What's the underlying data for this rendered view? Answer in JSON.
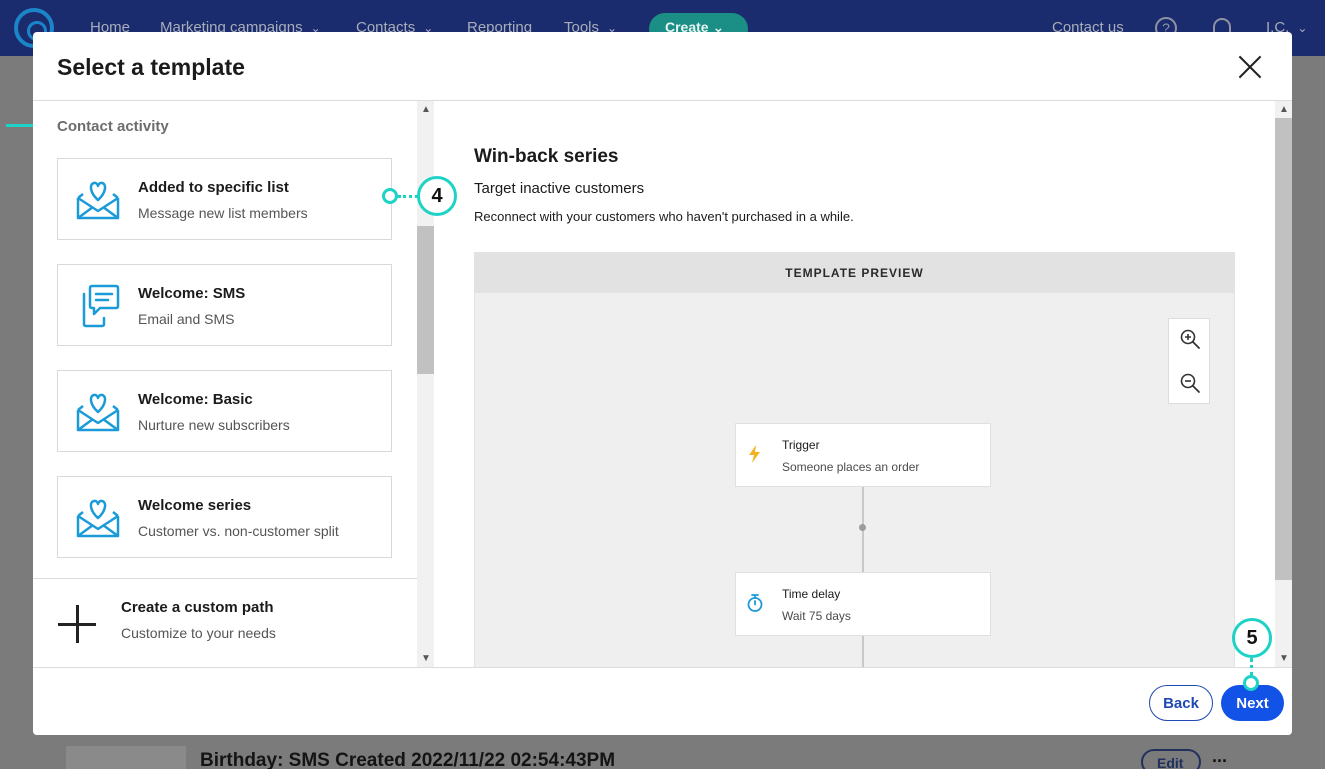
{
  "nav": {
    "items": [
      {
        "label": "Home",
        "dropdown": false
      },
      {
        "label": "Marketing campaigns",
        "dropdown": true
      },
      {
        "label": "Contacts",
        "dropdown": true
      },
      {
        "label": "Reporting",
        "dropdown": false
      },
      {
        "label": "Tools",
        "dropdown": true
      }
    ],
    "create_label": "Create",
    "contact_us": "Contact us",
    "user_initials": "I.C."
  },
  "background": {
    "row_title": "Birthday: SMS Created 2022/11/22 02:54:43PM",
    "edit_label": "Edit",
    "more_label": "..."
  },
  "modal": {
    "title": "Select a template",
    "section_label": "Contact activity",
    "templates": [
      {
        "title": "Added to specific list",
        "subtitle": "Message new list members",
        "icon": "envelope-heart-icon"
      },
      {
        "title": "Welcome: SMS",
        "subtitle": "Email and SMS",
        "icon": "phone-message-icon"
      },
      {
        "title": "Welcome: Basic",
        "subtitle": "Nurture new subscribers",
        "icon": "envelope-heart-icon"
      },
      {
        "title": "Welcome series",
        "subtitle": "Customer vs. non-customer split",
        "icon": "envelope-heart-icon"
      }
    ],
    "custom_path": {
      "title": "Create a custom path",
      "subtitle": "Customize to your needs"
    },
    "detail": {
      "title": "Win-back series",
      "subtitle": "Target inactive customers",
      "description": "Reconnect with your customers who haven't purchased in a while.",
      "preview_label": "TEMPLATE PREVIEW",
      "nodes": [
        {
          "title": "Trigger",
          "subtitle": "Someone places an order",
          "icon": "lightning-icon"
        },
        {
          "title": "Time delay",
          "subtitle": "Wait 75 days",
          "icon": "stopwatch-icon"
        }
      ]
    },
    "back_label": "Back",
    "next_label": "Next"
  },
  "callouts": {
    "step4": "4",
    "step5": "5"
  },
  "colors": {
    "accent": "#1252e6",
    "callout": "#1dd3c7",
    "icon_blue": "#1a9bd8",
    "nav_bg": "#1b2c6e"
  }
}
